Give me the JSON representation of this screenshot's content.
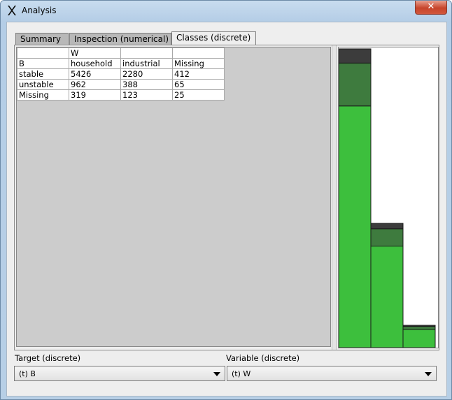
{
  "window": {
    "title": "Analysis",
    "close_glyph": "✕"
  },
  "tabs": [
    {
      "label": "Summary",
      "active": false
    },
    {
      "label": "Inspection (numerical)",
      "active": false
    },
    {
      "label": "Classes (discrete)",
      "active": true
    }
  ],
  "crosstab": {
    "rows": [
      [
        "",
        "W",
        "",
        ""
      ],
      [
        "B",
        "household",
        "industrial",
        "Missing"
      ],
      [
        "stable",
        "5426",
        "2280",
        "412"
      ],
      [
        "unstable",
        "962",
        "388",
        "65"
      ],
      [
        "Missing",
        "319",
        "123",
        "25"
      ]
    ]
  },
  "chart_data": {
    "type": "bar",
    "stacked": true,
    "categories": [
      "household",
      "industrial",
      "Missing"
    ],
    "series": [
      {
        "name": "stable",
        "values": [
          5426,
          2280,
          412
        ],
        "color": "#3dbf3d"
      },
      {
        "name": "unstable",
        "values": [
          962,
          388,
          65
        ],
        "color": "#3e7b3e"
      },
      {
        "name": "Missing",
        "values": [
          319,
          123,
          25
        ],
        "color": "#3c3c3c"
      }
    ],
    "grid": false,
    "legend": "none"
  },
  "target": {
    "label": "Target (discrete)",
    "value": "(t) B"
  },
  "variable": {
    "label": "Variable (discrete)",
    "value": "(t) W"
  }
}
